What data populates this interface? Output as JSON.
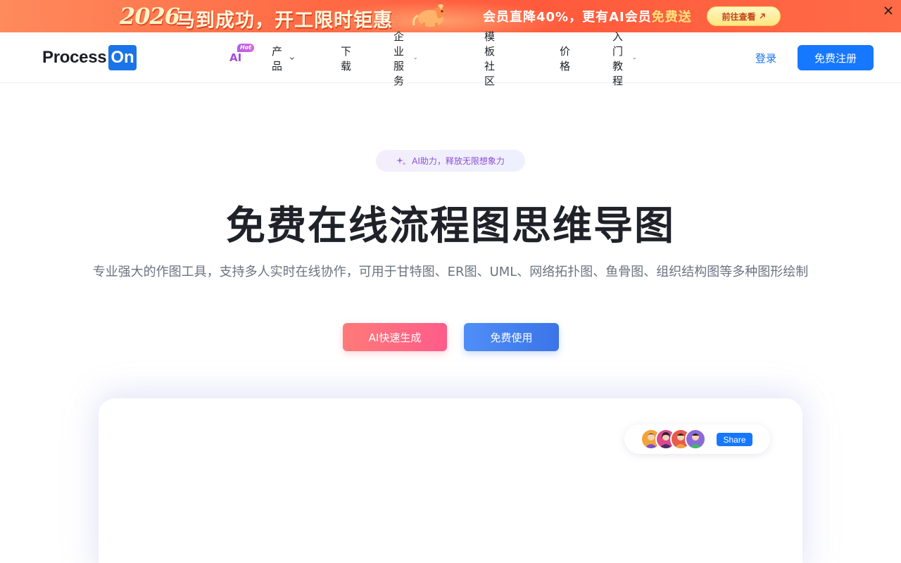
{
  "promo": {
    "year": "2026",
    "headline": "马到成功，开工限时钜惠",
    "offer_prefix": "会员直降40%，更有AI会员",
    "offer_highlight": "免费送",
    "cta_label": "前往查看",
    "colors": {
      "background": "#ff6a45",
      "cta_bg": "#ffe680",
      "cta_text": "#c2401c"
    }
  },
  "header": {
    "logo_text": "Process",
    "logo_box": "On",
    "nav": {
      "ai_label": "AI",
      "ai_badge": "Hot",
      "items": [
        {
          "label": "产品",
          "has_dropdown": true
        },
        {
          "label": "下载",
          "has_dropdown": false
        },
        {
          "label": "企业服务",
          "has_dropdown": true
        },
        {
          "label": "模板社区",
          "has_dropdown": false
        },
        {
          "label": "价格",
          "has_dropdown": false
        },
        {
          "label": "入门教程",
          "has_dropdown": true
        }
      ]
    },
    "login_label": "登录",
    "signup_label": "免费注册",
    "colors": {
      "brand": "#1677ff",
      "ai": "#a24de0"
    }
  },
  "hero": {
    "pill_text": "AI助力，释放无限想象力",
    "title": "免费在线流程图思维导图",
    "subtitle": "专业强大的作图工具，支持多人实时在线协作，可用于甘特图、ER图、UML、网络拓扑图、鱼骨图、组织结构图等多种图形绘制",
    "btn_ai_label": "AI快速生成",
    "btn_free_label": "免费使用"
  },
  "preview": {
    "share_label": "Share",
    "avatar_icons": [
      "avatar-icon-1",
      "avatar-icon-2",
      "avatar-icon-3",
      "avatar-icon-4"
    ]
  }
}
